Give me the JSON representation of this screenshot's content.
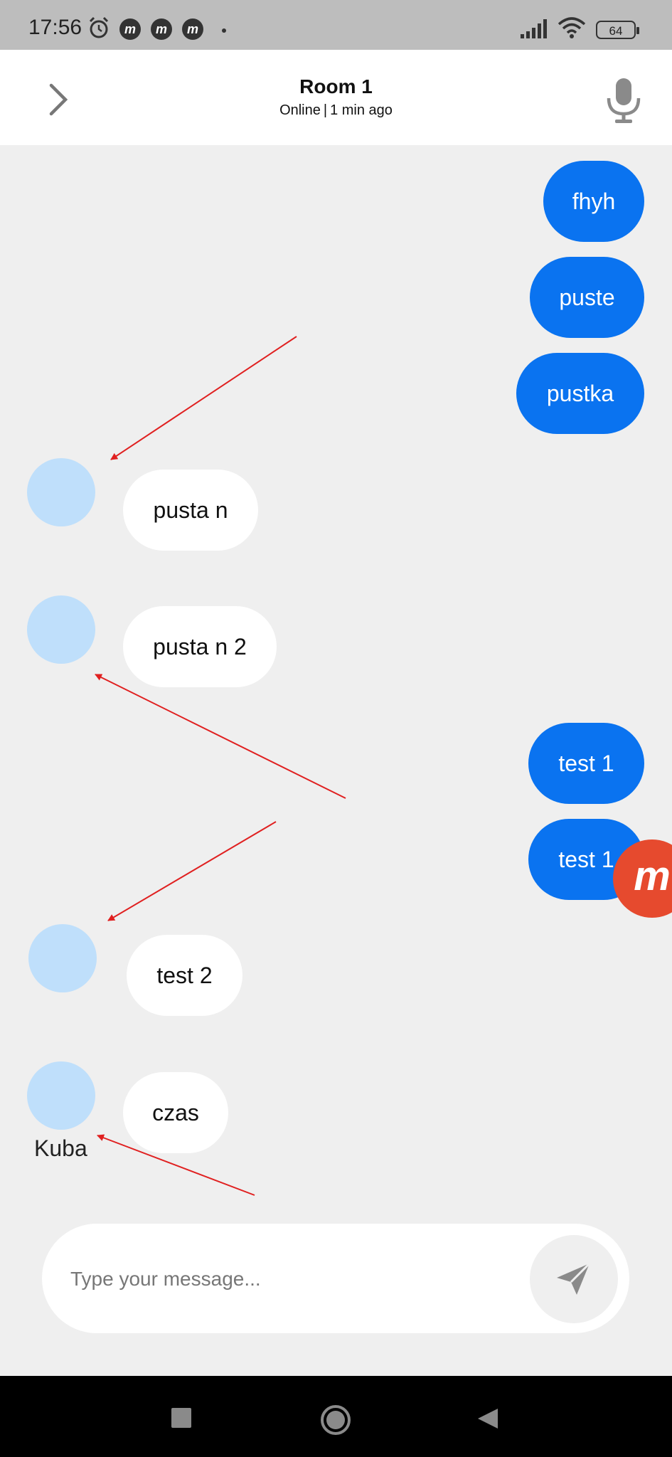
{
  "status_bar": {
    "time": "17:56",
    "icons": [
      "alarm-icon",
      "m-app-icon",
      "m-app-icon",
      "m-app-icon",
      "notification-dot-icon",
      "signal-icon",
      "wifi-icon",
      "battery-icon"
    ],
    "m_glyph": "m",
    "battery": "64"
  },
  "header": {
    "title": "Room 1",
    "status": "Online",
    "separator": "|",
    "last_seen": "1 min ago",
    "back_icon": "chevron-right-icon",
    "mic_icon": "microphone-icon"
  },
  "messages": [
    {
      "direction": "outgoing",
      "text": "fhyh"
    },
    {
      "direction": "outgoing",
      "text": "puste"
    },
    {
      "direction": "outgoing",
      "text": "pustka"
    },
    {
      "direction": "incoming",
      "text": "pusta n"
    },
    {
      "direction": "incoming",
      "text": "pusta n 2"
    },
    {
      "direction": "outgoing",
      "text": "test 1"
    },
    {
      "direction": "outgoing",
      "text": "test 1"
    },
    {
      "direction": "incoming",
      "text": "test 2"
    },
    {
      "direction": "incoming",
      "text": "czas",
      "sender": "Kuba"
    }
  ],
  "overlay": {
    "floating_app_glyph": "m",
    "floating_app_icon": "m-floating-app-icon",
    "annotation_arrow_color": "#e02020"
  },
  "composer": {
    "placeholder": "Type your message...",
    "value": "",
    "send_icon": "send-icon"
  },
  "colors": {
    "outgoing_bubble": "#0a73f0",
    "incoming_bubble": "#ffffff",
    "avatar": "#bfdffb",
    "background": "#efefef"
  },
  "nav_bar": {
    "icons": [
      "recents-square-icon",
      "home-circle-icon",
      "back-triangle-icon"
    ]
  }
}
